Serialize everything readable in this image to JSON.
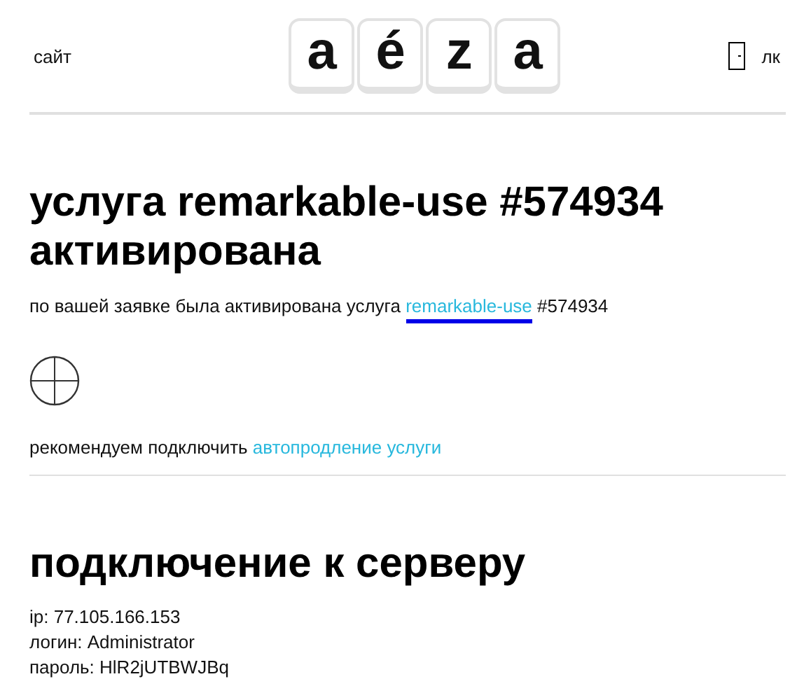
{
  "header": {
    "site_link": "сайт",
    "logo_letters": [
      "a",
      "é",
      "z",
      "a"
    ],
    "account_link": "лк"
  },
  "activation": {
    "title": "услуга remarkable-use #574934 активирована",
    "text_before": "по вашей заявке была активирована услуга",
    "service_link": "remarkable-use",
    "text_after": "#574934",
    "recommend_text": "рекомендуем подключить",
    "recommend_link": "автопродление услуги"
  },
  "connection": {
    "title": "подключение к серверу",
    "lines": [
      "ip: 77.105.166.153",
      "логин: Administrator",
      "пароль: HlR2jUTBWJBq"
    ]
  }
}
